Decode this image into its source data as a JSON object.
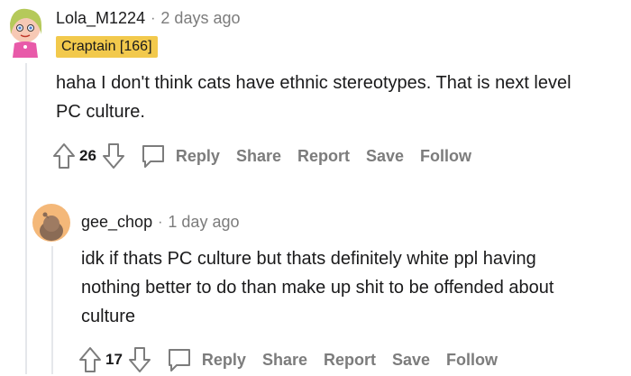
{
  "comments": [
    {
      "username": "Lola_M1224",
      "separator": "·",
      "time": "2 days ago",
      "flair": "Craptain [166]",
      "body": [
        "haha I don't think cats have ethnic stereotypes. That is next level",
        "PC culture."
      ],
      "votes": "26",
      "actions": {
        "reply": "Reply",
        "share": "Share",
        "report": "Report",
        "save": "Save",
        "follow": "Follow"
      }
    },
    {
      "username": "gee_chop",
      "separator": "·",
      "time": "1 day ago",
      "body": [
        "idk if thats PC culture but thats definitely white ppl having",
        "nothing better to do than make up shit to be offended about",
        "culture"
      ],
      "votes": "17",
      "actions": {
        "reply": "Reply",
        "share": "Share",
        "report": "Report",
        "save": "Save",
        "follow": "Follow"
      }
    }
  ],
  "colors": {
    "flair": "#f2c94c",
    "muted": "#7c7c7c",
    "text": "#1a1a1b",
    "avatar2_bg": "#f4b879"
  },
  "icons": [
    "upvote-arrow-icon",
    "downvote-arrow-icon",
    "comment-bubble-icon"
  ]
}
